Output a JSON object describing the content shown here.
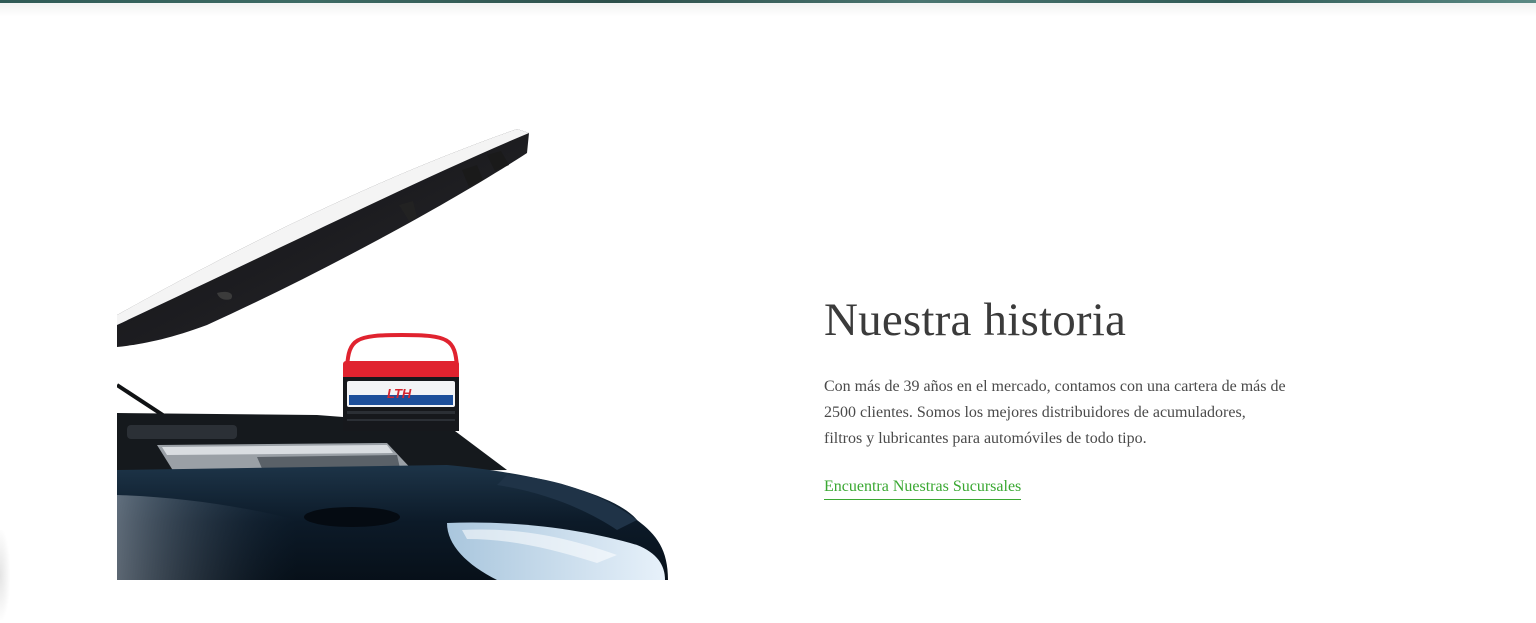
{
  "section": {
    "title": "Nuestra historia",
    "text": "Con más de 39 años en el mercado, contamos con una cartera de más de 2500 clientes. Somos los mejores distribuidores de acumuladores, filtros y lubricantes para automóviles de todo tipo.",
    "link_label": "Encuentra Nuestras Sucursales"
  },
  "image": {
    "battery_brand": "LTH"
  },
  "colors": {
    "link": "#3aa832",
    "title": "#3b3b3b",
    "text": "#4a4a4a",
    "car_body": "#0d1b2a",
    "battery_top": "#e0232f"
  }
}
